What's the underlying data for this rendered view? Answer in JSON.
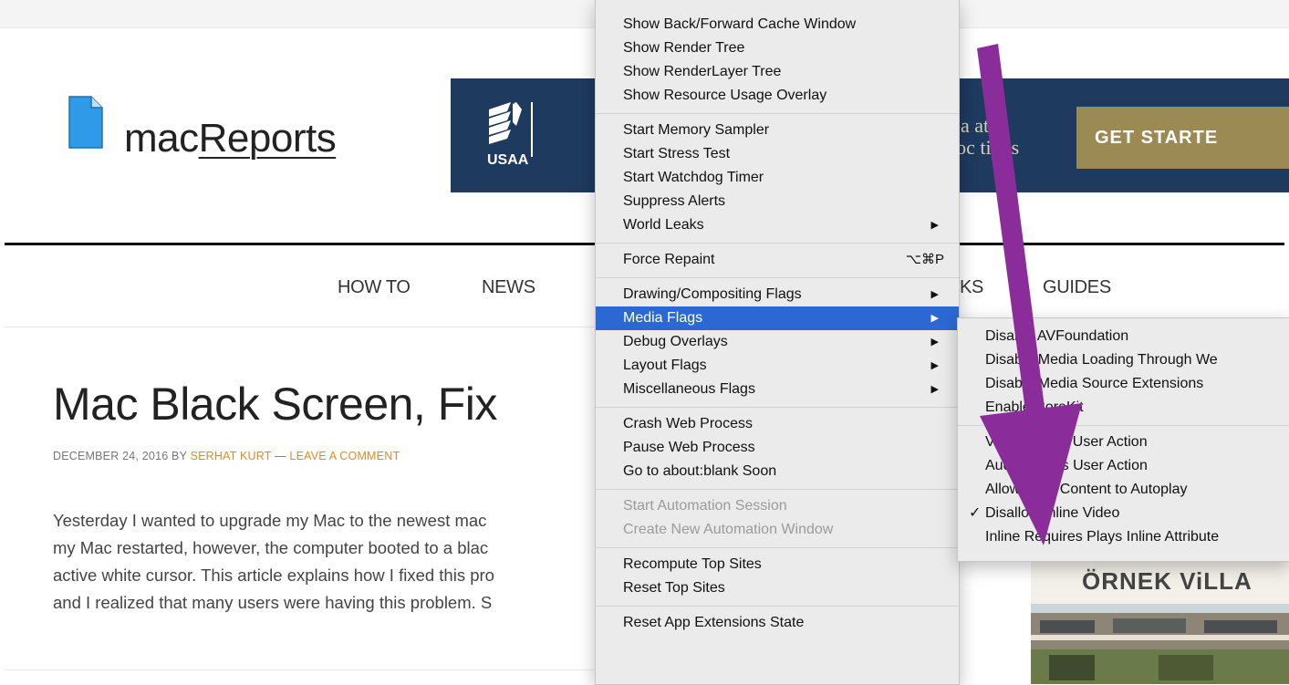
{
  "site": {
    "logo_text_plain": "mac",
    "logo_text_underlined": "Reports"
  },
  "ad": {
    "brand": "USAA",
    "text_line1": "pa at",
    "text_line2": "loc tions",
    "button": "GET STARTE"
  },
  "nav": [
    "HOW TO",
    "NEWS",
    "KS",
    "GUIDES"
  ],
  "article": {
    "title": "Mac Black Screen, Fix",
    "meta_prefix": "DECEMBER 24, 2016 BY ",
    "author": "SERHAT KURT",
    "meta_sep": " — ",
    "comment_link": "LEAVE A COMMENT",
    "body_lines": [
      "Yesterday I wanted to upgrade my Mac to the newest mac",
      "my Mac restarted, however, the computer booted to a blac",
      "active white cursor. This article explains how I fixed this pro",
      "and I realized that many users were having this problem. S"
    ]
  },
  "sidebar_ad": {
    "title": "ÖRNEK ViLLA"
  },
  "menu": {
    "groups": [
      [
        {
          "label": "Show Back/Forward Cache Window"
        },
        {
          "label": "Show Render Tree"
        },
        {
          "label": "Show RenderLayer Tree"
        },
        {
          "label": "Show Resource Usage Overlay"
        }
      ],
      [
        {
          "label": "Start Memory Sampler"
        },
        {
          "label": "Start Stress Test"
        },
        {
          "label": "Start Watchdog Timer"
        },
        {
          "label": "Suppress Alerts"
        },
        {
          "label": "World Leaks",
          "submenu": true
        }
      ],
      [
        {
          "label": "Force Repaint",
          "shortcut": "⌥⌘P"
        }
      ],
      [
        {
          "label": "Drawing/Compositing Flags",
          "submenu": true
        },
        {
          "label": "Media Flags",
          "submenu": true,
          "selected": true
        },
        {
          "label": "Debug Overlays",
          "submenu": true
        },
        {
          "label": "Layout Flags",
          "submenu": true
        },
        {
          "label": "Miscellaneous Flags",
          "submenu": true
        }
      ],
      [
        {
          "label": "Crash Web Process"
        },
        {
          "label": "Pause Web Process"
        },
        {
          "label": "Go to about:blank Soon"
        }
      ],
      [
        {
          "label": "Start Automation Session",
          "disabled": true
        },
        {
          "label": "Create New Automation Window",
          "disabled": true
        }
      ],
      [
        {
          "label": "Recompute Top Sites"
        },
        {
          "label": "Reset Top Sites"
        }
      ],
      [
        {
          "label": "Reset App Extensions State"
        }
      ]
    ]
  },
  "submenu": {
    "groups": [
      [
        {
          "label": "Disable AVFoundation"
        },
        {
          "label": "Disable Media Loading Through We"
        },
        {
          "label": "Disable Media Source Extensions"
        },
        {
          "label": "Enable CoreKit"
        }
      ],
      [
        {
          "label": "Video Needs User Action"
        },
        {
          "label": "Audio Needs User Action"
        },
        {
          "label": "Allow Main Content to Autoplay"
        },
        {
          "label": "Disallow Inline Video",
          "checked": true
        },
        {
          "label": "Inline Requires Plays Inline Attribute"
        }
      ]
    ]
  },
  "colors": {
    "menu_highlight": "#2c68d4",
    "annotation_arrow": "#8b2c9b",
    "link_orange": "#e08a1e",
    "ad_background": "#1e3a5f"
  },
  "icons": {
    "submenu_arrow": "▶",
    "check": "✓"
  }
}
